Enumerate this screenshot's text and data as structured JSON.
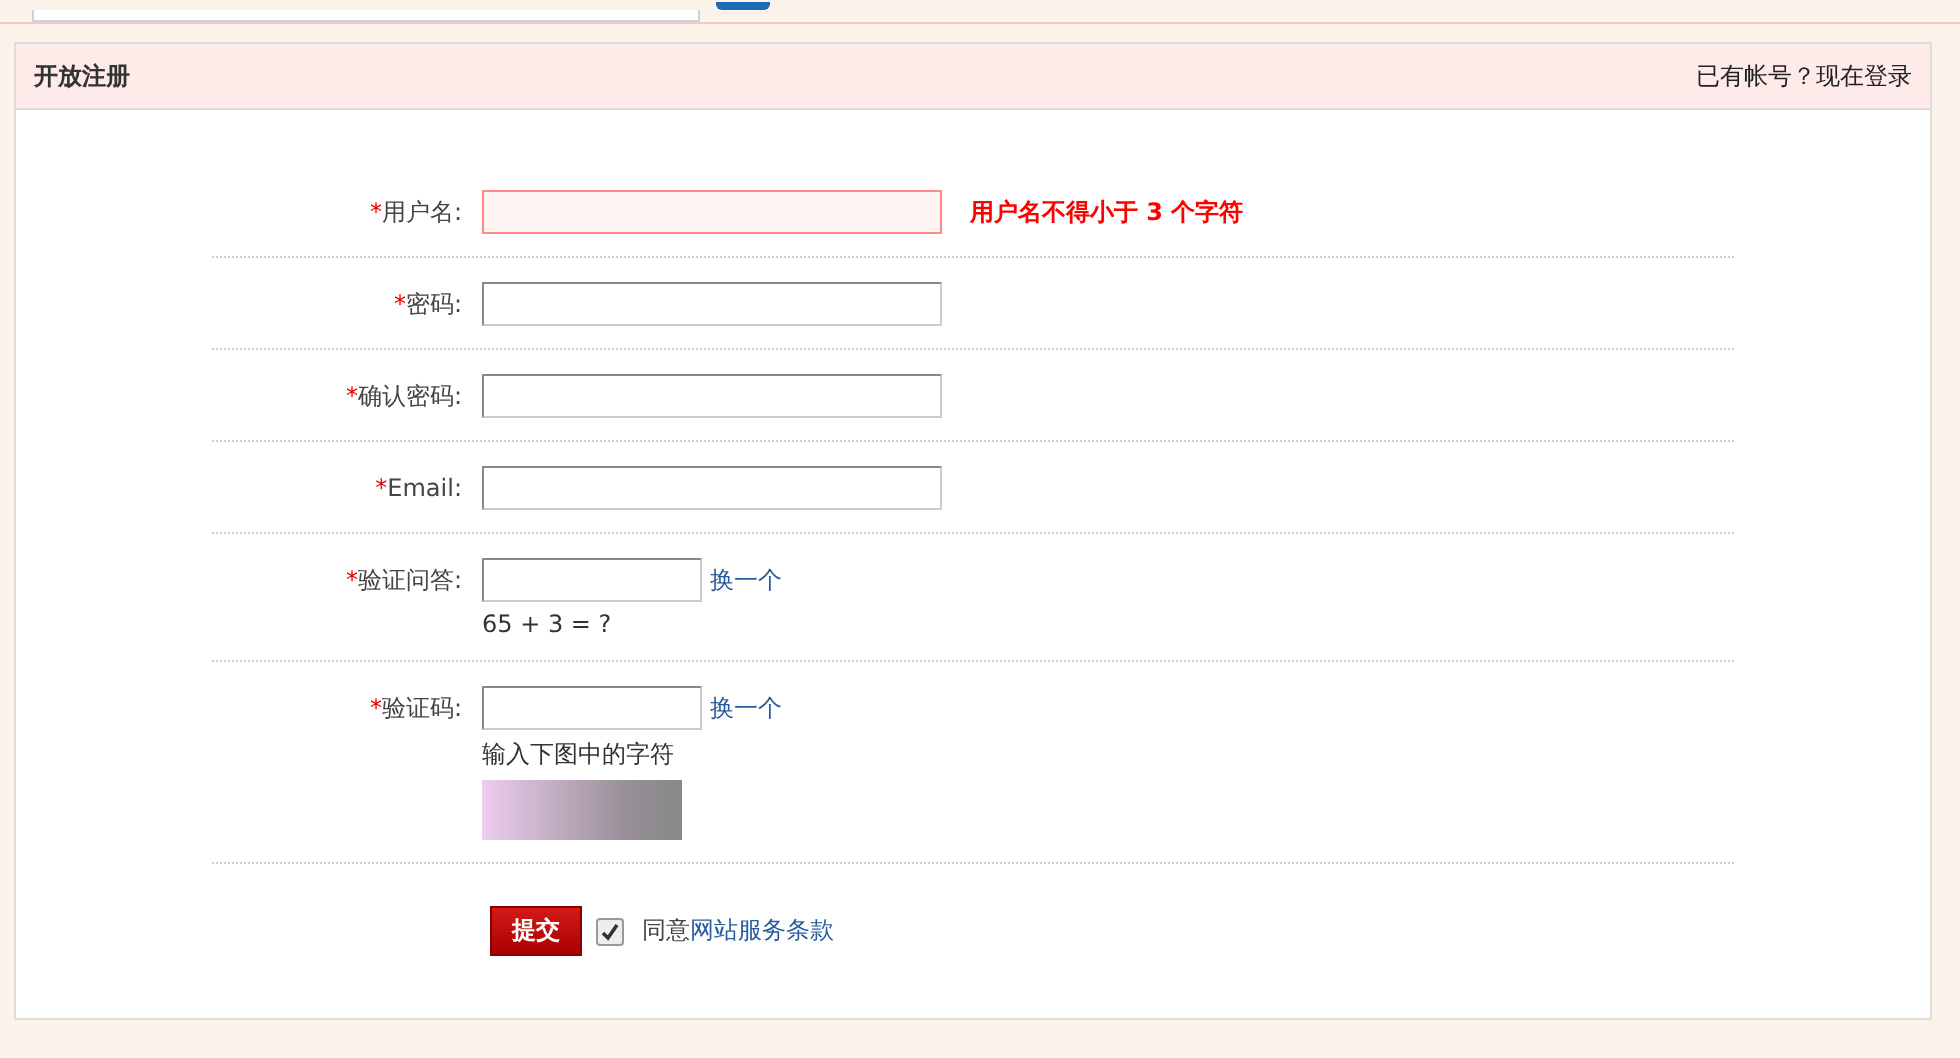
{
  "panel": {
    "title": "开放注册",
    "login_link": "已有帐号？现在登录"
  },
  "fields": [
    {
      "kind": "text",
      "required_mark": "*",
      "label": "用户名:",
      "error": true,
      "message": "用户名不得小于 3 个字符"
    },
    {
      "kind": "text",
      "required_mark": "*",
      "label": "密码:",
      "error": false
    },
    {
      "kind": "text",
      "required_mark": "*",
      "label": "确认密码:",
      "error": false
    },
    {
      "kind": "text",
      "required_mark": "*",
      "label": "Email:",
      "error": false
    },
    {
      "kind": "question",
      "required_mark": "*",
      "label": "验证问答:",
      "error": false,
      "refresh": "换一个",
      "hint": "65 + 3 = ?"
    },
    {
      "kind": "captcha",
      "required_mark": "*",
      "label": "验证码:",
      "error": false,
      "refresh": "换一个",
      "hint": "输入下图中的字符"
    }
  ],
  "submit": {
    "label": "提交"
  },
  "agree": {
    "checked": true,
    "text": "同意",
    "link": "网站服务条款"
  }
}
